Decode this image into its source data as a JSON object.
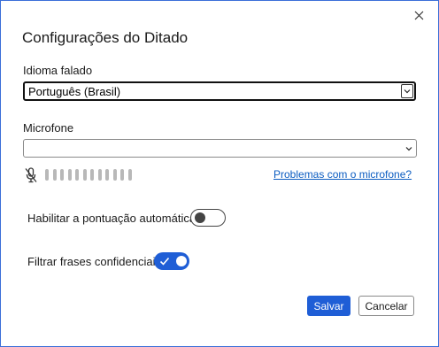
{
  "dialog": {
    "title": "Configurações do Ditado",
    "close_icon": "close-icon"
  },
  "language": {
    "label": "Idioma falado",
    "selected": "Português (Brasil)"
  },
  "microphone": {
    "label": "Microfone",
    "selected": "",
    "muted_icon": "microphone-muted-icon",
    "level_bar_count": 12,
    "level": 0,
    "help_link": "Problemas com o microfone?"
  },
  "options": {
    "auto_punctuation": {
      "label": "Habilitar a pontuação automática",
      "enabled": false
    },
    "filter_sensitive": {
      "label": "Filtrar frases confidenciais",
      "enabled": true
    }
  },
  "buttons": {
    "save": "Salvar",
    "cancel": "Cancelar"
  },
  "colors": {
    "accent": "#1f5ed6",
    "link": "#0b5cc1",
    "border": "#3a6fd8"
  }
}
